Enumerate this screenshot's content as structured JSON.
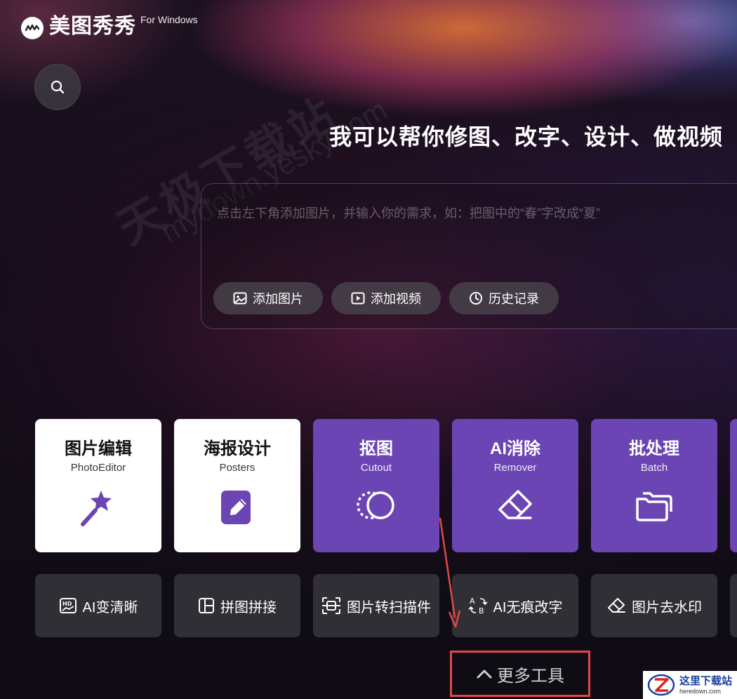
{
  "app": {
    "name": "美图秀秀",
    "name_suffix": "For Windows"
  },
  "watermark": {
    "cn": "天极下载站",
    "en": "mydown.yesky.com"
  },
  "headline": "我可以帮你修图、改字、设计、做视频",
  "prompt": {
    "placeholder": "点击左下角添加图片，并输入你的需求，如：把图中的“春”字改成“夏”",
    "actions": [
      {
        "label": "添加图片",
        "icon": "image-icon"
      },
      {
        "label": "添加视频",
        "icon": "video-icon"
      },
      {
        "label": "历史记录",
        "icon": "clock-icon"
      }
    ]
  },
  "tool_cards": [
    {
      "title": "图片编辑",
      "subtitle": "PhotoEditor",
      "icon": "magic-wand-icon",
      "style": "white"
    },
    {
      "title": "海报设计",
      "subtitle": "Posters",
      "icon": "edit-document-icon",
      "style": "white"
    },
    {
      "title": "抠图",
      "subtitle": "Cutout",
      "icon": "cutout-circle-icon",
      "style": "purple"
    },
    {
      "title": "AI消除",
      "subtitle": "Remover",
      "icon": "eraser-icon",
      "style": "purple"
    },
    {
      "title": "批处理",
      "subtitle": "Batch",
      "icon": "folders-icon",
      "style": "purple"
    }
  ],
  "quick_tools": [
    {
      "label": "AI变清晰",
      "icon": "hd-image-icon"
    },
    {
      "label": "拼图拼接",
      "icon": "collage-icon"
    },
    {
      "label": "图片转扫描件",
      "icon": "scan-icon"
    },
    {
      "label": "AI无痕改字",
      "icon": "text-replace-icon"
    },
    {
      "label": "图片去水印",
      "icon": "eraser-icon"
    }
  ],
  "more_tools": {
    "label": "更多工具",
    "icon": "chevron-up-icon"
  },
  "colors": {
    "card_purple": "#6b45b3",
    "card_white": "#ffffff",
    "highlight_red": "#e04848"
  },
  "corner_badge": {
    "title": "这里下载站",
    "subtitle": "heredown.com"
  }
}
